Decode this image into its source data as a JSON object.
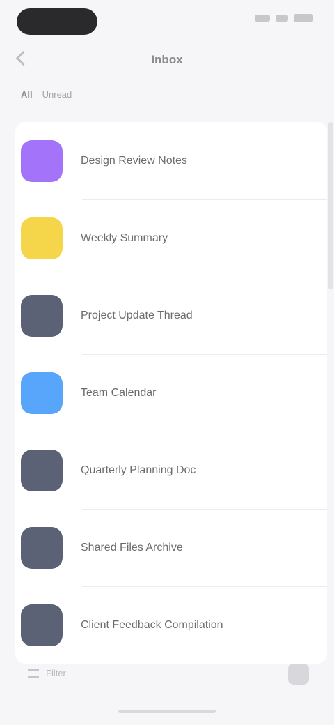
{
  "status_bar": {
    "icons": [
      "cellular-signal-icon",
      "wifi-icon",
      "battery-icon"
    ]
  },
  "nav": {
    "back_icon": "chevron-left-icon",
    "title": "Inbox"
  },
  "section": {
    "primary": "All",
    "secondary": "Unread"
  },
  "list": {
    "items": [
      {
        "label": "Design Review Notes",
        "icon_color": "#a374f9"
      },
      {
        "label": "Weekly Summary",
        "icon_color": "#f5d64a"
      },
      {
        "label": "Project Update Thread",
        "icon_color": "#5b6275"
      },
      {
        "label": "Team Calendar",
        "icon_color": "#57a6fb"
      },
      {
        "label": "Quarterly Planning Doc",
        "icon_color": "#5b6275"
      },
      {
        "label": "Shared Files Archive",
        "icon_color": "#5b6275"
      },
      {
        "label": "Client Feedback Compilation",
        "icon_color": "#5b6275"
      }
    ]
  },
  "bottom_bar": {
    "filter_icon": "filter-icon",
    "filter_label": "Filter",
    "compose_icon": "compose-icon"
  },
  "colors": {
    "background": "#f6f6f8",
    "card": "#ffffff"
  }
}
